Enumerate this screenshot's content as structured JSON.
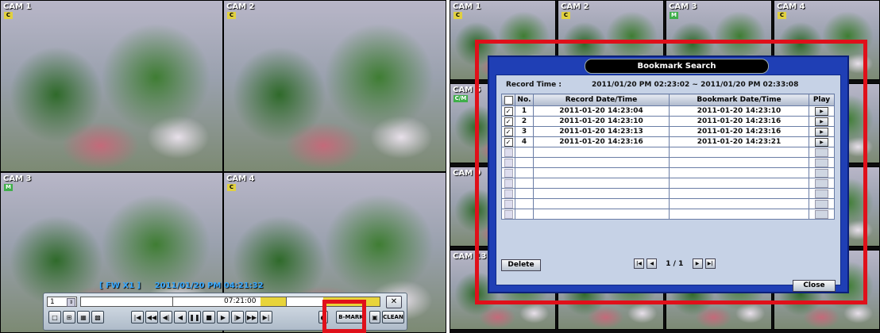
{
  "left_view": {
    "cameras": [
      {
        "label": "CAM 1",
        "badge": "C"
      },
      {
        "label": "CAM 2",
        "badge": "C"
      },
      {
        "label": "CAM 3",
        "badge": "M"
      },
      {
        "label": "CAM 4",
        "badge": "C"
      }
    ],
    "status": {
      "speed": "[ FW X1 ]",
      "datetime": "2011/01/20 PM 04:21:32"
    },
    "control_bar": {
      "channel": "1",
      "timeline_time": "07:21:00",
      "close": "✕",
      "layout_buttons": [
        "□",
        "⊞",
        "▦",
        "▩"
      ],
      "playback_buttons": [
        "|◀",
        "◀◀",
        "◀|",
        "◀",
        "❚❚",
        "■",
        "▶",
        "|▶",
        "▶▶",
        "▶|"
      ],
      "bmark_label": "B-MARK",
      "clean_label": "CLEAN"
    }
  },
  "right_view": {
    "cameras": [
      {
        "label": "CAM 1",
        "badge": "C"
      },
      {
        "label": "CAM 2",
        "badge": "C"
      },
      {
        "label": "CAM 3",
        "badge": "M"
      },
      {
        "label": "CAM 4",
        "badge": "C"
      },
      {
        "label": "CAM 5",
        "badge": "C/M"
      },
      {
        "label": "CAM 9",
        "badge": ""
      },
      {
        "label": "CAM 13",
        "badge": ""
      }
    ],
    "dialog": {
      "title": "Bookmark Search",
      "record_time_label": "Record Time :",
      "record_time_value": "2011/01/20 PM 02:23:02 ~ 2011/01/20 PM 02:33:08",
      "columns": [
        "No.",
        "Record Date/Time",
        "Bookmark Date/Time",
        "Play"
      ],
      "rows": [
        {
          "no": "1",
          "record": "2011-01-20 14:23:04",
          "bookmark": "2011-01-20 14:23:10"
        },
        {
          "no": "2",
          "record": "2011-01-20 14:23:10",
          "bookmark": "2011-01-20 14:23:16"
        },
        {
          "no": "3",
          "record": "2011-01-20 14:23:13",
          "bookmark": "2011-01-20 14:23:16"
        },
        {
          "no": "4",
          "record": "2011-01-20 14:23:16",
          "bookmark": "2011-01-20 14:23:21"
        }
      ],
      "empty_rows": 7,
      "delete_label": "Delete",
      "page": "1 / 1",
      "close_label": "Close"
    }
  },
  "colors": {
    "highlight": "#e0101a",
    "dialog_blue": "#1f3fb5",
    "status_blue": "#39a9ff"
  }
}
